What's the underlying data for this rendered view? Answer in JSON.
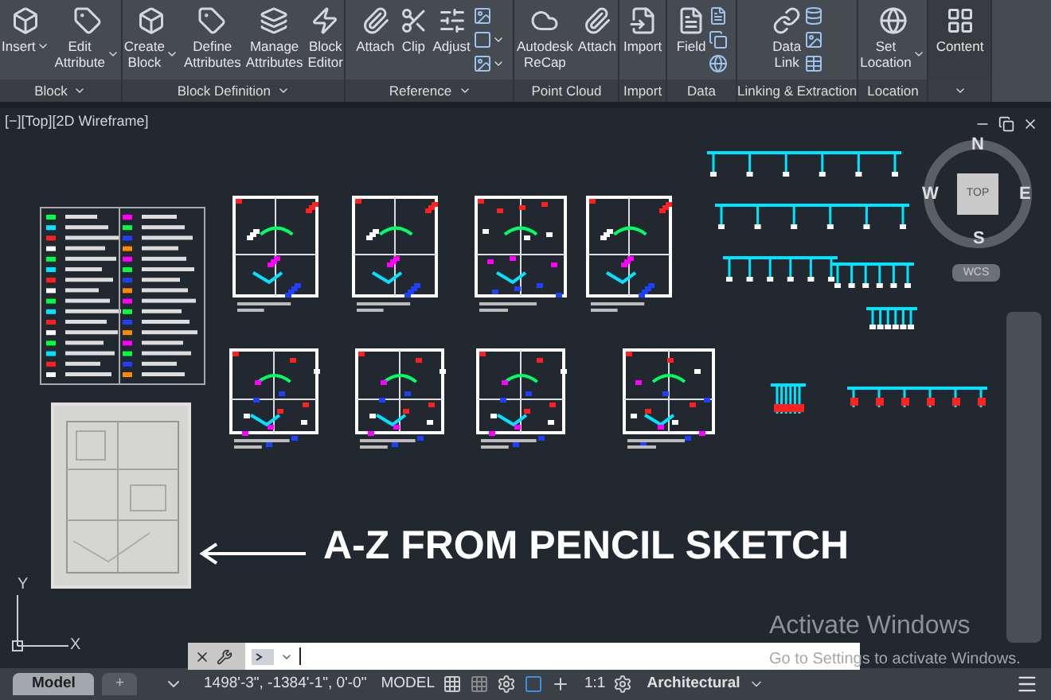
{
  "ribbon": {
    "panels": [
      {
        "label": "Block",
        "menu": true,
        "buttons": [
          {
            "lines": [
              "Insert"
            ],
            "menu": true
          },
          {
            "lines": [
              "Edit",
              "Attribute"
            ],
            "menu": true
          }
        ]
      },
      {
        "label": "Block Definition",
        "menu": true,
        "buttons": [
          {
            "lines": [
              "Create",
              "Block"
            ],
            "menu": true
          },
          {
            "lines": [
              "Define",
              "Attributes"
            ],
            "menu": false
          },
          {
            "lines": [
              "Manage",
              "Attributes"
            ],
            "menu": false
          },
          {
            "lines": [
              "Block",
              "Editor"
            ],
            "menu": false
          }
        ]
      },
      {
        "label": "Reference",
        "menu": true,
        "buttons": [
          {
            "lines": [
              "Attach"
            ],
            "menu": false
          },
          {
            "lines": [
              "Clip"
            ],
            "menu": false
          },
          {
            "lines": [
              "Adjust"
            ],
            "menu": false
          }
        ],
        "small_tools": [
          {
            "menu": false
          },
          {
            "menu": true
          },
          {
            "menu": true
          }
        ]
      },
      {
        "label": "Point Cloud",
        "menu": false,
        "buttons": [
          {
            "lines": [
              "Autodesk",
              "ReCap"
            ],
            "menu": false
          },
          {
            "lines": [
              "Attach"
            ],
            "menu": false
          }
        ]
      },
      {
        "label": "Import",
        "menu": false,
        "buttons": [
          {
            "lines": [
              "Import"
            ],
            "menu": false
          }
        ]
      },
      {
        "label": "Data",
        "menu": false,
        "buttons": [
          {
            "lines": [
              "Field"
            ],
            "menu": false
          }
        ],
        "small_tools": [
          {
            "menu": false
          },
          {
            "menu": false
          },
          {
            "menu": false
          }
        ]
      },
      {
        "label": "Linking & Extraction",
        "menu": false,
        "buttons": [
          {
            "lines": [
              "Data",
              "Link"
            ],
            "menu": false
          }
        ],
        "small_tools": [
          {
            "menu": false
          },
          {
            "menu": false
          },
          {
            "menu": false
          }
        ]
      },
      {
        "label": "Location",
        "menu": false,
        "buttons": [
          {
            "lines": [
              "Set",
              "Location"
            ],
            "menu": true
          }
        ]
      },
      {
        "menu": true,
        "selected": true,
        "buttons": [
          {
            "lines": [
              "Content"
            ],
            "menu": false
          }
        ]
      }
    ]
  },
  "viewport": {
    "label": "[−][Top][2D Wireframe]",
    "viewcube": {
      "north": "N",
      "west": "W",
      "east": "E",
      "south": "S",
      "face": "TOP",
      "ucs": "WCS"
    },
    "axes": {
      "y": "Y",
      "x": "X"
    }
  },
  "overlay": {
    "headline": "A-Z FROM PENCIL SKETCH"
  },
  "activation_notice": {
    "title": "Activate Windows",
    "body": "Go to Settings to activate Windows."
  },
  "status_bar": {
    "tabs": [
      {
        "label": "Model",
        "selected": true
      }
    ],
    "add_tab": "+",
    "coordinates": "1498'-3\", -1384'-1\", 0'-0\"",
    "space": "MODEL",
    "scale": "1:1",
    "units": "Architectural"
  }
}
